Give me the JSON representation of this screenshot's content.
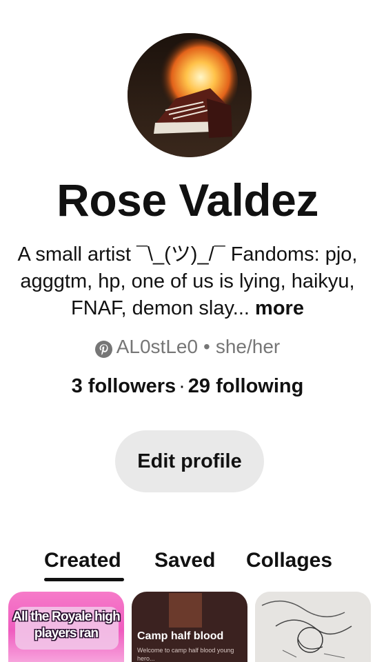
{
  "profile": {
    "name": "Rose Valdez",
    "bio_text": "A small artist ¯\\_(ツ)_/¯ Fandoms: pjo, agggtm, hp, one of us is lying, haikyu, FNAF, demon slay...",
    "bio_more": "more",
    "username": "AL0stLe0",
    "separator": "•",
    "pronouns": "she/her",
    "followers": "3 followers",
    "follow_sep": "·",
    "following": "29 following",
    "edit_label": "Edit profile",
    "username_icon": "pinterest-icon"
  },
  "tabs": [
    {
      "label": "Created",
      "active": true
    },
    {
      "label": "Saved",
      "active": false
    },
    {
      "label": "Collages",
      "active": false
    }
  ],
  "pins": [
    {
      "line1": "All the Royale high",
      "line2": "players ran"
    },
    {
      "title": "Camp half blood",
      "subtitle": "Welcome to camp half blood young hero..."
    },
    {
      "image": "pencil-sketch-drawing"
    }
  ],
  "colors": {
    "accent_text": "#111111",
    "muted_text": "#767676",
    "button_bg": "#e9e9e9"
  }
}
